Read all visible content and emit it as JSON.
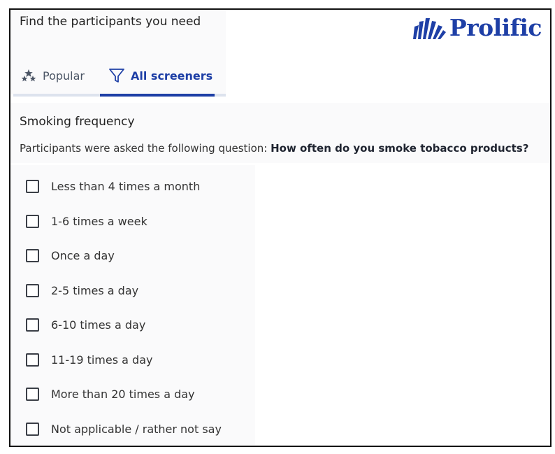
{
  "header": {
    "title": "Find the participants you need",
    "logo_text": "Prolific",
    "logo_icon": "prolific-sunburst-logo",
    "brand_color": "#1e3fa6"
  },
  "tabs": [
    {
      "label": "Popular",
      "icon": "stars-icon",
      "active": false
    },
    {
      "label": "All screeners",
      "icon": "filter-funnel-icon",
      "active": true
    }
  ],
  "screener": {
    "title": "Smoking frequency",
    "question_prefix": "Participants were asked the following question: ",
    "question": "How often do you smoke tobacco products?",
    "options": [
      {
        "label": "Less than 4 times a month",
        "checked": false
      },
      {
        "label": "1-6 times a week",
        "checked": false
      },
      {
        "label": "Once a day",
        "checked": false
      },
      {
        "label": "2-5 times a day",
        "checked": false
      },
      {
        "label": "6-10 times a day",
        "checked": false
      },
      {
        "label": "11-19 times a day",
        "checked": false
      },
      {
        "label": "More than 20 times a day",
        "checked": false
      },
      {
        "label": "Not applicable / rather not say",
        "checked": false
      }
    ]
  }
}
